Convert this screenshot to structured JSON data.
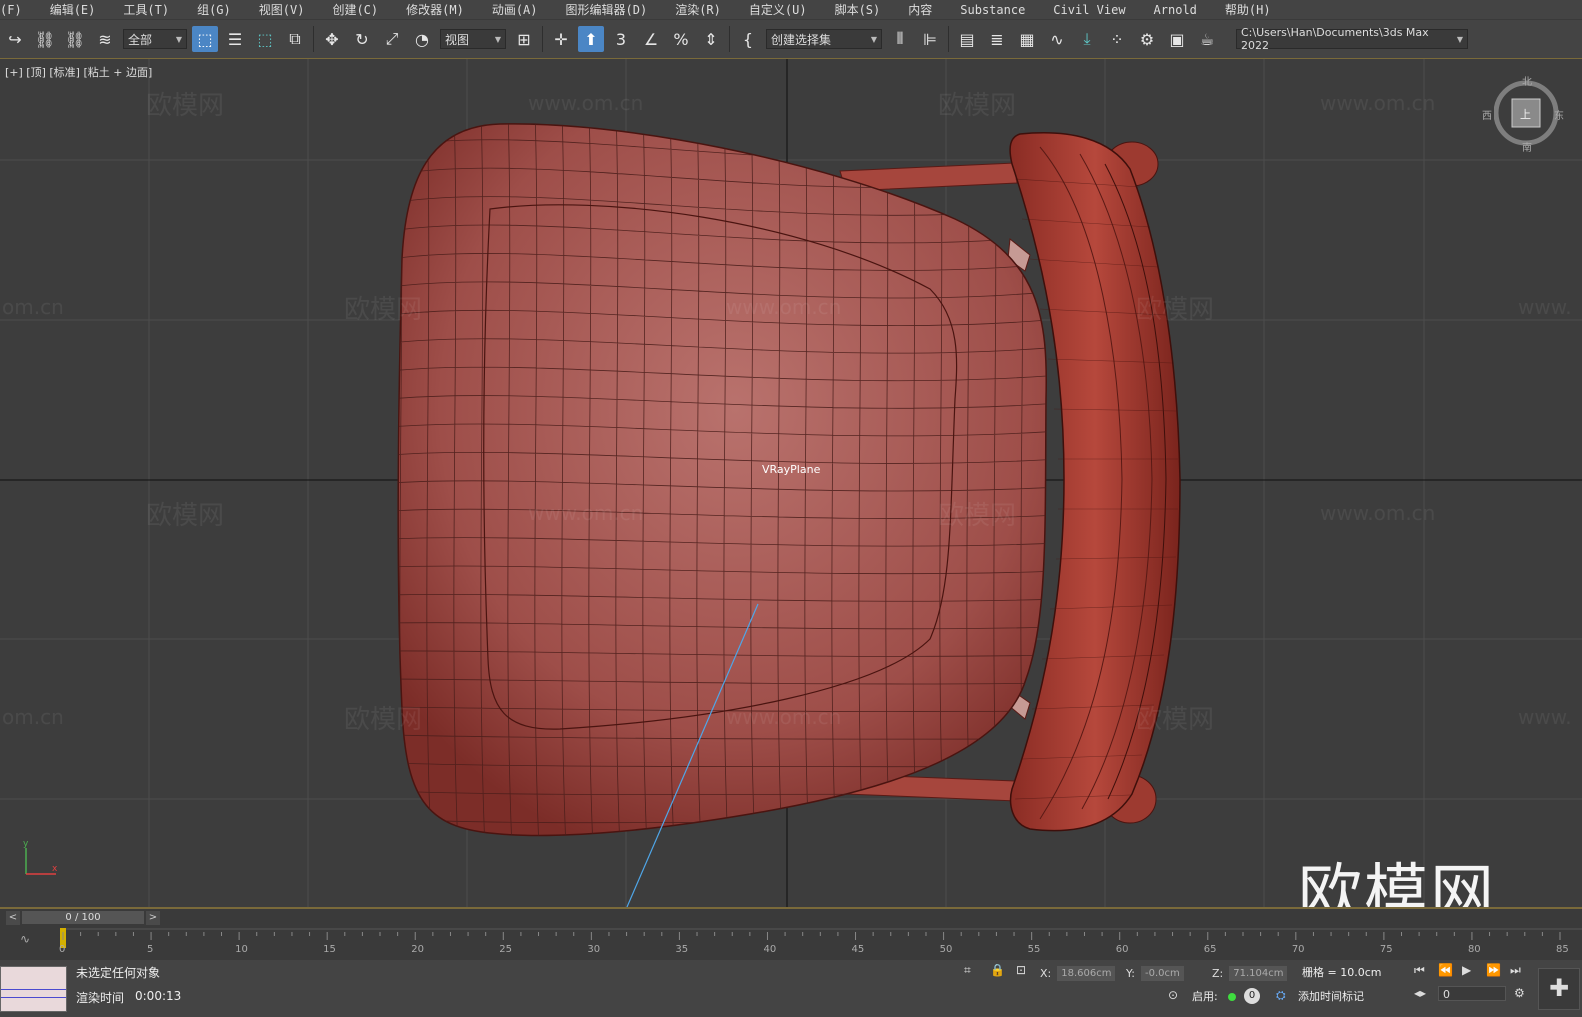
{
  "menu": [
    "(F)",
    "编辑(E)",
    "工具(T)",
    "组(G)",
    "视图(V)",
    "创建(C)",
    "修改器(M)",
    "动画(A)",
    "图形编辑器(D)",
    "渲染(R)",
    "自定义(U)",
    "脚本(S)",
    "内容",
    "Substance",
    "Civil View",
    "Arnold",
    "帮助(H)"
  ],
  "toolbar": {
    "selection_filter": "全部",
    "ref_coord": "视图",
    "named_sel": "创建选择集",
    "path": "C:\\Users\\Han\\Documents\\3ds Max 2022",
    "snap_value": "3"
  },
  "viewport": {
    "label": "[+] [顶] [标准] [粘土 + 边面]",
    "object_label": "VRayPlane",
    "watermark_cn": "欧模网",
    "watermark_url": "www.om.cn",
    "url_partial": "om.cn",
    "url_partial_right": "www.",
    "big_logo": "欧模网",
    "navcube": {
      "n": "北",
      "s": "南",
      "e": "东",
      "w": "西",
      "face": "上"
    }
  },
  "timeline": {
    "frame": "0 / 100",
    "ticks": [
      "0",
      "5",
      "10",
      "15",
      "20",
      "25",
      "30",
      "35",
      "40",
      "45",
      "50",
      "55",
      "60",
      "65",
      "70",
      "75",
      "80",
      "85"
    ]
  },
  "status": {
    "selection": "未选定任何对象",
    "render_time_label": "渲染时间",
    "render_time": "0:00:13",
    "x_label": "X:",
    "x": "18.606cm",
    "y_label": "Y:",
    "y": "-0.0cm",
    "z_label": "Z:",
    "z": "71.104cm",
    "grid": "栅格 = 10.0cm",
    "enable": "启用:",
    "add_tag": "添加时间标记",
    "frame_field": "0",
    "zero": "0"
  }
}
